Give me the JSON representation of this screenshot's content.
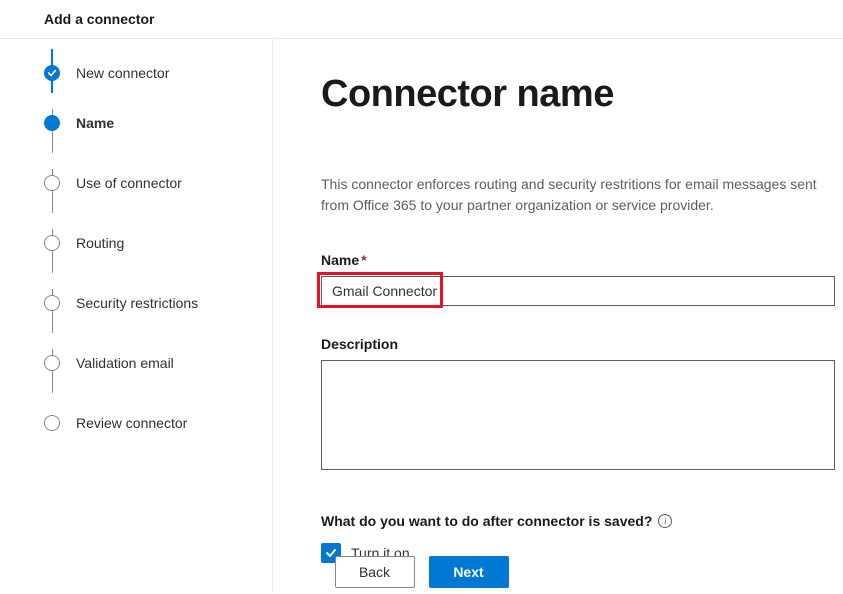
{
  "header": {
    "title": "Add a connector"
  },
  "stepper": {
    "items": [
      {
        "label": "New connector",
        "status": "completed"
      },
      {
        "label": "Name",
        "status": "current"
      },
      {
        "label": "Use of connector",
        "status": "pending"
      },
      {
        "label": "Routing",
        "status": "pending"
      },
      {
        "label": "Security restrictions",
        "status": "pending"
      },
      {
        "label": "Validation email",
        "status": "pending"
      },
      {
        "label": "Review connector",
        "status": "pending"
      }
    ]
  },
  "main": {
    "page_title": "Connector name",
    "intro": "This connector enforces routing and security restritions for email messages sent from Office 365 to your partner organization or service provider.",
    "name_label": "Name",
    "name_value": "Gmail Connector",
    "description_label": "Description",
    "description_value": "",
    "save_question": "What do you want to do after connector is saved?",
    "turn_on_label": "Turn it on",
    "turn_on_checked": true
  },
  "footer": {
    "back_label": "Back",
    "next_label": "Next"
  }
}
